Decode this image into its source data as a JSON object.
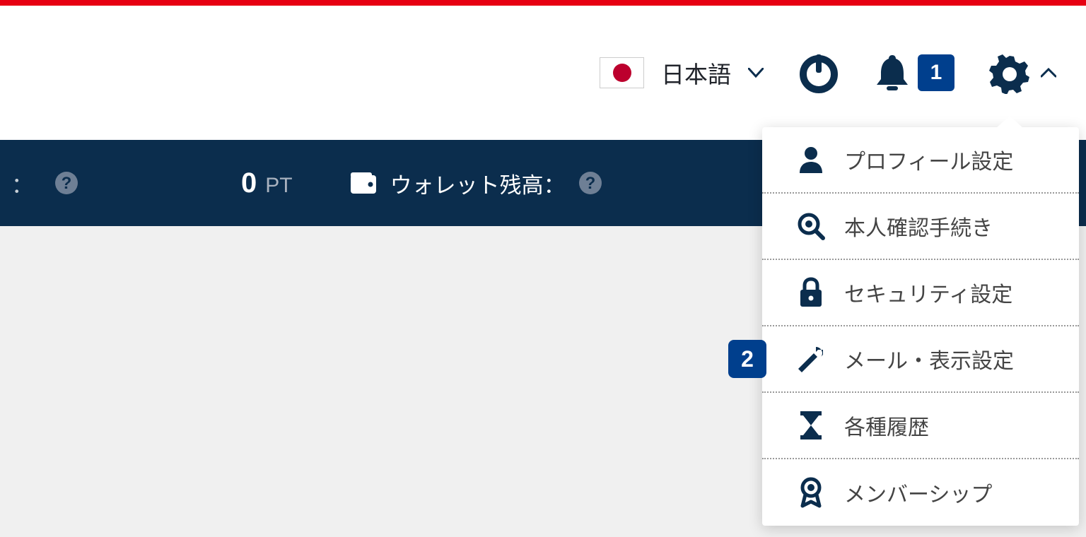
{
  "header": {
    "language_label": "日本語",
    "notification_count": "1"
  },
  "info_bar": {
    "leading_colon": "：",
    "points_value": "0",
    "points_unit": "PT",
    "wallet_label": "ウォレット残高：",
    "balance_value": ""
  },
  "settings_menu": {
    "items": [
      {
        "label": "プロフィール設定",
        "icon": "user-icon",
        "badge": null
      },
      {
        "label": "本人確認手続き",
        "icon": "identity-icon",
        "badge": null
      },
      {
        "label": "セキュリティ設定",
        "icon": "lock-icon",
        "badge": null
      },
      {
        "label": "メール・表示設定",
        "icon": "wrench-icon",
        "badge": "2"
      },
      {
        "label": "各種履歴",
        "icon": "hourglass-icon",
        "badge": null
      },
      {
        "label": "メンバーシップ",
        "icon": "ribbon-icon",
        "badge": null
      }
    ]
  }
}
